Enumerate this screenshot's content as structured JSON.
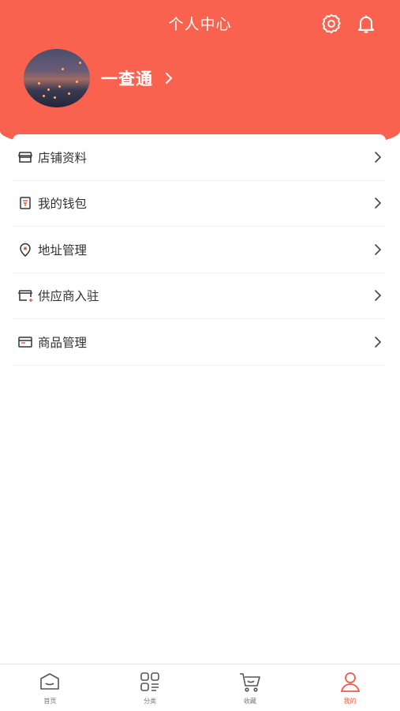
{
  "header": {
    "title": "个人中心",
    "icons": [
      "gear-icon",
      "bell-icon"
    ]
  },
  "profile": {
    "username": "一查通",
    "avatar": "avatar-image"
  },
  "menu": {
    "items": [
      {
        "label": "店铺资料",
        "icon": "store-icon"
      },
      {
        "label": "我的钱包",
        "icon": "wallet-icon"
      },
      {
        "label": "地址管理",
        "icon": "location-pin-icon"
      },
      {
        "label": "供应商入驻",
        "icon": "supplier-icon"
      },
      {
        "label": "商品管理",
        "icon": "goods-icon"
      }
    ]
  },
  "tabbar": {
    "items": [
      {
        "label": "首页",
        "icon": "home-icon",
        "active": false
      },
      {
        "label": "分类",
        "icon": "category-icon",
        "active": false
      },
      {
        "label": "收藏",
        "icon": "cart-icon",
        "active": false
      },
      {
        "label": "我的",
        "icon": "user-icon",
        "active": true
      }
    ]
  },
  "colors": {
    "primary": "#f8624f",
    "active_tab": "#f05a47"
  }
}
